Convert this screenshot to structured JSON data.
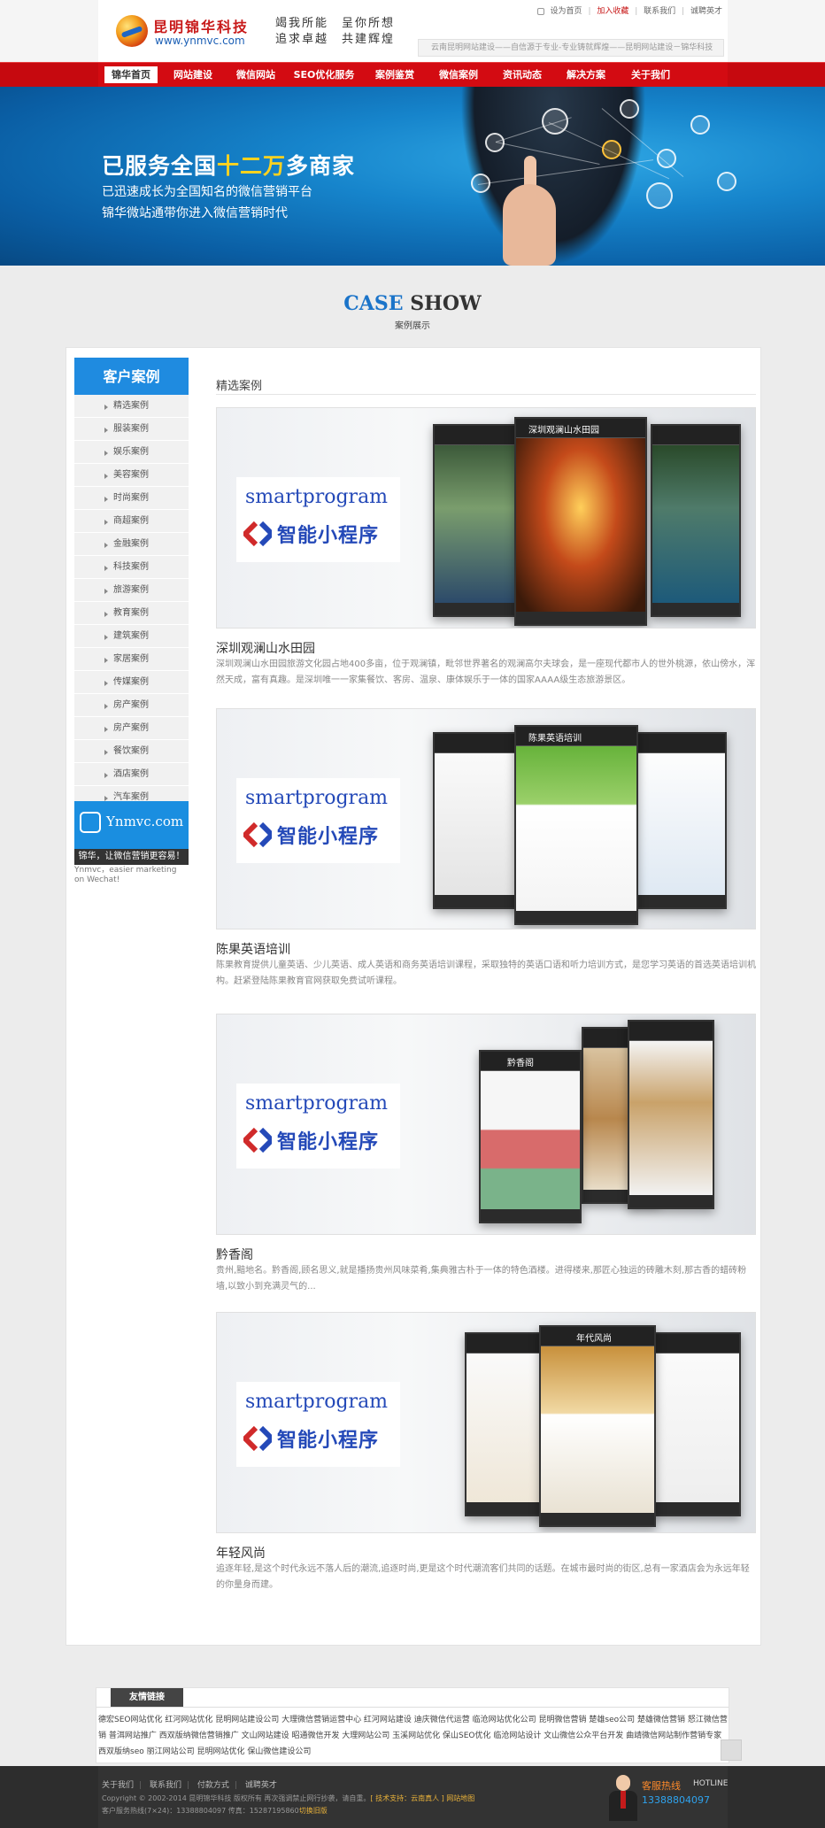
{
  "header": {
    "logo_cn": "昆明锦华科技",
    "logo_url": "www.ynmvc.com",
    "slogan_line1": "竭我所能　呈你所想",
    "slogan_line2": "追求卓越　共建辉煌",
    "links": {
      "home": "设为首页",
      "fav": "加入收藏",
      "contact": "联系我们",
      "hire": "诚聘英才"
    },
    "marquee": "云南昆明网站建设——自信源于专业-专业铸就辉煌——昆明网站建设－锦华科技"
  },
  "nav": [
    "锦华首页",
    "网站建设",
    "微信网站",
    "SEO优化服务",
    "案例鉴赏",
    "微信案例",
    "资讯动态",
    "解决方案",
    "关于我们"
  ],
  "banner": {
    "headline_pre": "已服务全国",
    "headline_hl": "十二万",
    "headline_post": "多商家",
    "line2": "已迅速成长为全国知名的微信营销平台",
    "line3": "锦华微站通带你进入微信营销时代"
  },
  "section": {
    "title_a": "CASE",
    "title_b": "SHOW",
    "subtitle": "案例展示"
  },
  "sidebar": {
    "title": "客户案例",
    "items": [
      "精选案例",
      "服装案例",
      "娱乐案例",
      "美容案例",
      "时尚案例",
      "商超案例",
      "金融案例",
      "科技案例",
      "旅游案例",
      "教育案例",
      "建筑案例",
      "家居案例",
      "传媒案例",
      "房产案例",
      "房产案例",
      "餐饮案例",
      "酒店案例",
      "汽车案例"
    ],
    "ad": {
      "url": "Ynmvc.com",
      "slogan": "锦华，让微信营销更容易！",
      "caption": "Ynmvc，easier marketing on Wechat!"
    }
  },
  "main": {
    "heading": "精选案例",
    "sp_label": "smartprogram",
    "sp_cn": "智能小程序",
    "cases": [
      {
        "title": "深圳观澜山水田园",
        "desc": "深圳观澜山水田园旅游文化园占地400多亩，位于观澜镇，毗邻世界著名的观澜高尔夫球会，是一座现代都市人的世外桃源，依山傍水，浑然天成，富有真趣。是深圳唯一一家集餐饮、客房、温泉、康体娱乐于一体的国家AAAA级生态旅游景区。",
        "phone_title": "深圳观澜山水田园"
      },
      {
        "title": "陈果英语培训",
        "desc": "陈果教育提供儿童英语、少儿英语、成人英语和商务英语培训课程，采取独特的英语口语和听力培训方式，是您学习英语的首选英语培训机构。赶紧登陆陈果教育官网获取免费试听课程。",
        "phone_title": "陈果英语培训"
      },
      {
        "title": "黔香阁",
        "desc": "贵州,黯地名。黔香阁,顾名思义,就是播扬贵州风味菜肴,集典雅古朴于一体的特色酒楼。进得楼来,那匠心独运的砖雕木刻,那古香的蜡砖粉墙,以致小到充满灵气的...",
        "phone_title": "黔香阁"
      },
      {
        "title": "年轻风尚",
        "desc": "追逐年轻,是这个时代永远不落人后的潮流,追逐时尚,更是这个时代潮流客们共同的话题。在城市最时尚的街区,总有一家酒店会为永远年轻的你量身而建。",
        "phone_title": "年代风尚"
      }
    ]
  },
  "links": {
    "tab": "友情链接",
    "text": "德宏SEO网站优化 红河网站优化 昆明网站建设公司 大理微信营销运营中心 红河网站建设 迪庆微信代运营 临沧网站优化公司 昆明微信营销 楚雄seo公司 楚雄微信营销 怒江微信营销 普洱网站推广 西双版纳微信营销推广 文山网站建设 昭通微信开发 大理网站公司 玉溪网站优化 保山SEO优化 临沧网站设计 文山微信公众平台开发 曲靖微信网站制作营销专家 西双版纳seo 丽江网站公司 昆明网站优化 保山微信建设公司"
  },
  "footer": {
    "links": [
      "关于我们",
      "联系我们",
      "付款方式",
      "诚聘英才"
    ],
    "copy_pre": "Copyright © 2002-2014  昆明锦华科技  版权所有  再次强调禁止网行抄袭，请自重。",
    "copy_hl": "[ 技术支持：云南真人 ] 网站地图",
    "tel_pre": "客户服务热线(7×24)：13388804097   传真：15287195860",
    "tel_hl": "切换旧版",
    "hotline": "客服热线",
    "hotline_en": "HOTLINE",
    "phone": "13388804097"
  }
}
